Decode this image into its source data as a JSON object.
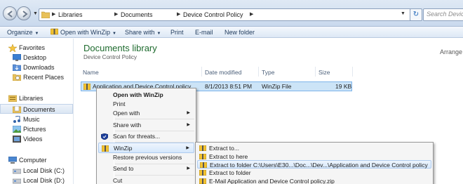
{
  "address": {
    "crumbs": [
      "Libraries",
      "Documents",
      "Device Control Policy"
    ],
    "search_placeholder": "Search Device C"
  },
  "toolbar": {
    "organize": "Organize",
    "open_with_winzip": "Open with WinZip",
    "share_with": "Share with",
    "print": "Print",
    "email": "E-mail",
    "new_folder": "New folder"
  },
  "nav": {
    "favorites": "Favorites",
    "desktop": "Desktop",
    "downloads": "Downloads",
    "recent_places": "Recent Places",
    "libraries": "Libraries",
    "documents": "Documents",
    "music": "Music",
    "pictures": "Pictures",
    "videos": "Videos",
    "computer": "Computer",
    "local_disk_c": "Local Disk (C:)",
    "local_disk_d": "Local Disk (D:)"
  },
  "main": {
    "title": "Documents library",
    "subtitle": "Device Control Policy",
    "arrange": "Arrange",
    "columns": {
      "name": "Name",
      "date": "Date modified",
      "type": "Type",
      "size": "Size"
    },
    "file": {
      "name": "Application and Device Control policy",
      "date": "8/1/2013 8:51 PM",
      "type": "WinZip File",
      "size": "19 KB"
    }
  },
  "context_menu": {
    "open_with_winzip": "Open with WinZip",
    "print": "Print",
    "open_with": "Open with",
    "share_with": "Share with",
    "scan": "Scan for threats...",
    "winzip": "WinZip",
    "restore": "Restore previous versions",
    "send_to": "Send to",
    "cut": "Cut"
  },
  "winzip_submenu": {
    "extract_to": "Extract to...",
    "extract_here": "Extract to here",
    "extract_folder_path": "Extract to folder C:\\Users\\E30...\\Doc...\\Dev...\\Application and Device Control policy",
    "extract_to_folder": "Extract to folder",
    "email_zip": "E-Mail Application and Device Control policy.zip"
  },
  "colors": {
    "library_title": "#1e6b2e",
    "selection": "#cce4f7",
    "toolbar_text": "#1e395b"
  }
}
